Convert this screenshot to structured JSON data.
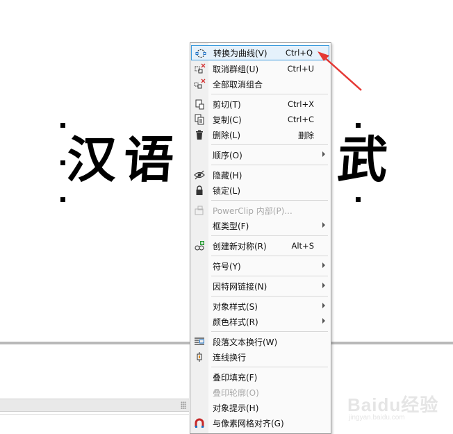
{
  "canvas": {
    "artwork_text_visible": "汉语",
    "artwork_text_tail": "武"
  },
  "menu": {
    "items": [
      {
        "label": "转换为曲线(V)",
        "shortcut": "Ctrl+Q",
        "icon": "convert-to-curves-icon",
        "state": "highlighted"
      },
      {
        "label": "取消群组(U)",
        "shortcut": "Ctrl+U",
        "icon": "ungroup-icon"
      },
      {
        "label": "全部取消组合",
        "shortcut": "",
        "icon": "ungroup-all-icon"
      },
      {
        "label": "剪切(T)",
        "shortcut": "Ctrl+X",
        "icon": "cut-icon"
      },
      {
        "label": "复制(C)",
        "shortcut": "Ctrl+C",
        "icon": "copy-icon"
      },
      {
        "label": "删除(L)",
        "shortcut": "删除",
        "icon": "trash-icon"
      },
      {
        "label": "顺序(O)",
        "shortcut": "",
        "submenu": true
      },
      {
        "label": "隐藏(H)",
        "shortcut": "",
        "icon": "hide-eye-icon"
      },
      {
        "label": "锁定(L)",
        "shortcut": "",
        "icon": "lock-icon"
      },
      {
        "label": "PowerClip 内部(P)...",
        "shortcut": "",
        "icon": "powerclip-icon",
        "state": "disabled"
      },
      {
        "label": "框类型(F)",
        "shortcut": "",
        "submenu": true
      },
      {
        "label": "创建新对称(R)",
        "shortcut": "Alt+S",
        "icon": "symmetry-icon"
      },
      {
        "label": "符号(Y)",
        "shortcut": "",
        "submenu": true
      },
      {
        "label": "因特网链接(N)",
        "shortcut": "",
        "submenu": true
      },
      {
        "label": "对象样式(S)",
        "shortcut": "",
        "submenu": true
      },
      {
        "label": "颜色样式(R)",
        "shortcut": "",
        "submenu": true
      },
      {
        "label": "段落文本换行(W)",
        "shortcut": "",
        "icon": "text-wrap-icon"
      },
      {
        "label": "连线换行",
        "shortcut": "",
        "icon": "connector-wrap-icon"
      },
      {
        "label": "叠印填充(F)",
        "shortcut": ""
      },
      {
        "label": "叠印轮廓(O)",
        "shortcut": "",
        "state": "disabled"
      },
      {
        "label": "对象提示(H)",
        "shortcut": ""
      },
      {
        "label": "与像素网格对齐(G)",
        "shortcut": "",
        "icon": "pixel-snap-magnet-icon"
      }
    ]
  },
  "watermark": {
    "brand": "Baidu经验",
    "sub": "jingyan.baidu.com"
  },
  "colors": {
    "highlight_bg": "#e5f1fb",
    "highlight_border": "#3b9bde",
    "annotation_arrow": "#e53935"
  }
}
